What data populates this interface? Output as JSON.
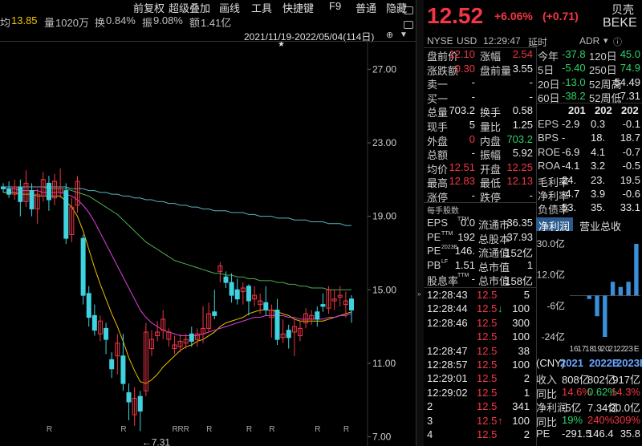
{
  "toolbar": {
    "items": [
      "前复权",
      "超级叠加",
      "画线",
      "工具",
      "快捷键",
      "F9",
      "普通",
      "隐藏"
    ]
  },
  "stats_bar": {
    "avg_label": "均",
    "avg_value": "13.85",
    "vol_label": "量",
    "vol_value": "1020万",
    "turnover_label": "换",
    "turnover_value": "0.84%",
    "amp_label": "振",
    "amp_value": "9.08%",
    "amount_label": "额",
    "amount_value": "1.41亿"
  },
  "range_label": "2021/11/19-2022/05/04(114日)",
  "chart_data": {
    "type": "candlestick",
    "ylim": [
      6.5,
      28.5
    ],
    "y_ticks": [
      "27.00",
      "23.00",
      "19.00",
      "15.00",
      "11.00",
      "7.00"
    ],
    "y_tick_values": [
      27,
      23,
      19,
      15,
      11,
      7
    ],
    "low_annotation": "←7.31",
    "low_value": 7.31,
    "marker": "R",
    "candles": [
      {
        "o": 20.6,
        "c": 20.5,
        "h": 20.8,
        "l": 20.3
      },
      {
        "o": 20.5,
        "c": 20.2,
        "h": 20.9,
        "l": 20.0
      },
      {
        "o": 20.2,
        "c": 20.6,
        "h": 21.0,
        "l": 19.9
      },
      {
        "o": 20.6,
        "c": 19.8,
        "h": 21.0,
        "l": 19.0
      },
      {
        "o": 19.8,
        "c": 20.8,
        "h": 21.5,
        "l": 19.5
      },
      {
        "o": 20.4,
        "c": 19.4,
        "h": 20.8,
        "l": 19.0
      },
      {
        "o": 19.4,
        "c": 20.2,
        "h": 20.5,
        "l": 18.6
      },
      {
        "o": 20.1,
        "c": 21.0,
        "h": 21.4,
        "l": 19.8
      },
      {
        "o": 20.8,
        "c": 19.9,
        "h": 21.2,
        "l": 19.3
      },
      {
        "o": 20.0,
        "c": 20.9,
        "h": 21.3,
        "l": 19.6
      },
      {
        "o": 20.3,
        "c": 20.5,
        "h": 21.6,
        "l": 20.0
      },
      {
        "o": 20.4,
        "c": 17.8,
        "h": 20.8,
        "l": 17.5
      },
      {
        "o": 18.0,
        "c": 19.5,
        "h": 20.0,
        "l": 17.6
      },
      {
        "o": 19.6,
        "c": 20.9,
        "h": 21.2,
        "l": 19.2
      },
      {
        "o": 17.8,
        "c": 14.7,
        "h": 18.0,
        "l": 14.2
      },
      {
        "o": 14.8,
        "c": 13.5,
        "h": 15.2,
        "l": 13.0
      },
      {
        "o": 13.6,
        "c": 12.8,
        "h": 14.2,
        "l": 12.5
      },
      {
        "o": 12.6,
        "c": 13.3,
        "h": 13.6,
        "l": 12.2
      },
      {
        "o": 12.9,
        "c": 12.3,
        "h": 13.2,
        "l": 11.5
      },
      {
        "o": 11.2,
        "c": 10.7,
        "h": 11.6,
        "l": 10.2
      },
      {
        "o": 11.4,
        "c": 12.1,
        "h": 12.6,
        "l": 10.4
      },
      {
        "o": 11.4,
        "c": 9.9,
        "h": 12.6,
        "l": 9.5
      },
      {
        "o": 9.4,
        "c": 8.9,
        "h": 9.9,
        "l": 7.9
      },
      {
        "o": 8.2,
        "c": 9.1,
        "h": 9.7,
        "l": 7.6
      },
      {
        "o": 9.2,
        "c": 8.4,
        "h": 9.5,
        "l": 7.31
      },
      {
        "o": 9.5,
        "c": 12.7,
        "h": 13.2,
        "l": 9.2
      },
      {
        "o": 11.8,
        "c": 12.3,
        "h": 12.8,
        "l": 11.4
      },
      {
        "o": 12.5,
        "c": 12.7,
        "h": 13.3,
        "l": 12.2
      },
      {
        "o": 12.8,
        "c": 13.4,
        "h": 13.9,
        "l": 12.3
      },
      {
        "o": 12.3,
        "c": 12.7,
        "h": 12.9,
        "l": 11.9
      },
      {
        "o": 11.8,
        "c": 12.0,
        "h": 12.5,
        "l": 11.5
      },
      {
        "o": 11.9,
        "c": 12.2,
        "h": 12.6,
        "l": 11.6
      },
      {
        "o": 12.1,
        "c": 12.3,
        "h": 12.6,
        "l": 11.8
      },
      {
        "o": 12.6,
        "c": 12.2,
        "h": 13.0,
        "l": 11.9
      },
      {
        "o": 12.3,
        "c": 12.6,
        "h": 12.9,
        "l": 11.9
      },
      {
        "o": 12.6,
        "c": 12.9,
        "h": 14.1,
        "l": 12.1
      },
      {
        "o": 12.9,
        "c": 13.7,
        "h": 14.3,
        "l": 12.7
      },
      {
        "o": 13.8,
        "c": 13.6,
        "h": 15.0,
        "l": 13.4
      },
      {
        "o": 16.0,
        "c": 16.3,
        "h": 16.5,
        "l": 15.4
      },
      {
        "o": 15.7,
        "c": 15.4,
        "h": 16.0,
        "l": 15.1
      },
      {
        "o": 15.4,
        "c": 14.7,
        "h": 15.9,
        "l": 14.3
      },
      {
        "o": 15.0,
        "c": 14.5,
        "h": 15.6,
        "l": 14.2
      },
      {
        "o": 14.9,
        "c": 15.1,
        "h": 15.4,
        "l": 14.2
      },
      {
        "o": 15.2,
        "c": 14.4,
        "h": 15.3,
        "l": 13.6
      },
      {
        "o": 14.5,
        "c": 14.7,
        "h": 15.2,
        "l": 14.1
      },
      {
        "o": 14.2,
        "c": 14.4,
        "h": 14.8,
        "l": 13.7
      },
      {
        "o": 14.3,
        "c": 13.9,
        "h": 15.2,
        "l": 13.6
      },
      {
        "o": 13.5,
        "c": 13.9,
        "h": 14.2,
        "l": 12.4
      },
      {
        "o": 13.9,
        "c": 12.3,
        "h": 14.5,
        "l": 12.0
      },
      {
        "o": 12.4,
        "c": 12.6,
        "h": 13.4,
        "l": 12.1
      },
      {
        "o": 12.8,
        "c": 12.4,
        "h": 13.1,
        "l": 11.8
      },
      {
        "o": 12.7,
        "c": 13.0,
        "h": 13.4,
        "l": 11.4
      },
      {
        "o": 12.5,
        "c": 12.9,
        "h": 13.3,
        "l": 12.2
      },
      {
        "o": 13.2,
        "c": 13.7,
        "h": 14.0,
        "l": 12.9
      },
      {
        "o": 13.4,
        "c": 13.6,
        "h": 13.9,
        "l": 13.1
      },
      {
        "o": 13.8,
        "c": 13.4,
        "h": 14.1,
        "l": 13.0
      },
      {
        "o": 14.2,
        "c": 14.1,
        "h": 14.8,
        "l": 13.8
      },
      {
        "o": 14.0,
        "c": 15.0,
        "h": 15.2,
        "l": 13.7
      },
      {
        "o": 14.4,
        "c": 14.5,
        "h": 15.0,
        "l": 13.9
      },
      {
        "o": 14.6,
        "c": 14.7,
        "h": 15.2,
        "l": 14.1
      },
      {
        "o": 14.2,
        "c": 14.4,
        "h": 14.9,
        "l": 13.5
      },
      {
        "o": 14.5,
        "c": 13.9,
        "h": 14.7,
        "l": 13.2
      }
    ],
    "ma_lines": [
      {
        "name": "ma-yellow",
        "color": "#e8c000",
        "values": [
          20.3,
          20.3,
          20.3,
          20.2,
          20.2,
          20.2,
          20.1,
          20.1,
          20.1,
          20.1,
          20.1,
          19.8,
          19.5,
          19.0,
          18.2,
          17.2,
          16.2,
          15.3,
          14.5,
          13.7,
          13.0,
          12.2,
          11.3,
          10.6,
          10.0,
          9.9,
          10.1,
          10.4,
          10.8,
          11.1,
          11.4,
          11.7,
          11.9,
          12.0,
          12.2,
          12.3,
          12.5,
          12.7,
          13.0,
          13.2,
          13.3,
          13.4,
          13.5,
          13.7,
          13.8,
          13.9,
          13.9,
          13.9,
          13.8,
          13.7,
          13.6,
          13.4,
          13.3,
          13.3,
          13.3,
          13.3,
          13.3,
          13.4,
          13.5,
          13.6,
          13.7,
          13.8
        ]
      },
      {
        "name": "ma-magenta",
        "color": "#e040e0",
        "values": [
          20.5,
          20.5,
          20.5,
          20.4,
          20.4,
          20.4,
          20.4,
          20.3,
          20.3,
          20.3,
          20.3,
          20.2,
          20.1,
          19.9,
          19.6,
          19.2,
          18.7,
          18.1,
          17.5,
          16.9,
          16.3,
          15.7,
          15.1,
          14.5,
          13.9,
          13.5,
          13.2,
          13.0,
          12.8,
          12.7,
          12.6,
          12.5,
          12.5,
          12.5,
          12.5,
          12.6,
          12.7,
          12.8,
          12.9,
          13.0,
          13.1,
          13.2,
          13.3,
          13.4,
          13.5,
          13.5,
          13.6,
          13.6,
          13.6,
          13.6,
          13.5,
          13.5,
          13.4,
          13.4,
          13.4,
          13.4,
          13.4,
          13.5,
          13.5,
          13.6,
          13.6,
          13.7
        ]
      },
      {
        "name": "ma-green",
        "color": "#4caf50",
        "values": [
          20.6,
          20.6,
          20.6,
          20.6,
          20.6,
          20.6,
          20.6,
          20.6,
          20.5,
          20.5,
          20.5,
          20.5,
          20.4,
          20.3,
          20.2,
          20.1,
          19.9,
          19.7,
          19.5,
          19.3,
          19.1,
          18.8,
          18.5,
          18.2,
          17.9,
          17.6,
          17.4,
          17.2,
          17.0,
          16.8,
          16.6,
          16.5,
          16.4,
          16.3,
          16.2,
          16.1,
          16.0,
          15.9,
          15.9,
          15.8,
          15.8,
          15.7,
          15.7,
          15.6,
          15.6,
          15.5,
          15.5,
          15.5,
          15.4,
          15.4,
          15.3,
          15.3,
          15.2,
          15.2,
          15.1,
          15.1,
          15.1,
          15.0,
          15.0,
          15.0,
          15.0,
          15.0
        ]
      },
      {
        "name": "ma-cyan",
        "color": "#5ab4be",
        "values": [
          20.6,
          20.6,
          20.6,
          20.6,
          20.6,
          20.6,
          20.6,
          20.6,
          20.6,
          20.6,
          20.6,
          20.6,
          20.5,
          20.5,
          20.5,
          20.4,
          20.4,
          20.3,
          20.3,
          20.2,
          20.2,
          20.1,
          20.1,
          20.0,
          20.0,
          19.9,
          19.9,
          19.8,
          19.8,
          19.7,
          19.7,
          19.6,
          19.6,
          19.5,
          19.5,
          19.4,
          19.4,
          19.3,
          19.3,
          19.3,
          19.2,
          19.2,
          19.2,
          19.1,
          19.1,
          19.0,
          19.0,
          19.0,
          18.9,
          18.9,
          18.9,
          18.8,
          18.8,
          18.8,
          18.7,
          18.7,
          18.7,
          18.6,
          18.6,
          18.6,
          18.5,
          18.5
        ]
      }
    ]
  },
  "quote": {
    "price": "12.52",
    "change_pct": "+6.06%",
    "change": "(+0.71)",
    "name_cn": "贝壳",
    "ticker": "BEKE",
    "exchange": "NYSE",
    "currency": "USD",
    "time": "12:29:47",
    "delay": "延时",
    "adr": "ADR"
  },
  "left_table": [
    {
      "l": "盘前价",
      "v": "12.10",
      "c": "r"
    },
    {
      "l": "涨跌额",
      "v": "0.30",
      "c": "r"
    },
    {
      "l": "卖一",
      "v": "-",
      "c": "w"
    },
    {
      "l": "买一",
      "v": "-",
      "c": "w"
    },
    {
      "l": "总量",
      "v": "703.2",
      "c": "w"
    },
    {
      "l": "现手",
      "v": "5",
      "c": "w"
    },
    {
      "l": "外盘",
      "v": "0",
      "c": "r"
    },
    {
      "l": "总额",
      "v": "-",
      "c": "w"
    },
    {
      "l": "均价",
      "v": "12.51",
      "c": "r"
    },
    {
      "l": "最高",
      "v": "12.83",
      "c": "r"
    },
    {
      "l": "涨停",
      "v": "-",
      "c": "w"
    }
  ],
  "mid_table": [
    {
      "l": "涨幅",
      "v": "2.54",
      "c": "r"
    },
    {
      "l": "盘前量",
      "v": "3.55",
      "c": "w"
    },
    {
      "l": "",
      "v": "-",
      "c": "w"
    },
    {
      "l": "",
      "v": "-",
      "c": "w"
    },
    {
      "l": "换手",
      "v": "0.58",
      "c": "w"
    },
    {
      "l": "量比",
      "v": "1.25",
      "c": "w"
    },
    {
      "l": "内盘",
      "v": "703.2",
      "c": "g"
    },
    {
      "l": "振幅",
      "v": "5.92",
      "c": "w"
    },
    {
      "l": "开盘",
      "v": "12.25",
      "c": "r"
    },
    {
      "l": "最低",
      "v": "12.13",
      "c": "r"
    },
    {
      "l": "跌停",
      "v": "-",
      "c": "w"
    }
  ],
  "fundamentals_header": "每手股数",
  "fund_table": [
    {
      "l": "EPS",
      "sup": "TTM",
      "v": "0.0",
      "l2": "流通市",
      "v2": "36.35"
    },
    {
      "l": "PE",
      "sup": "TTM",
      "v": "192",
      "l2": "总股本",
      "v2": "37.93"
    },
    {
      "l": "PE",
      "sup": "2023E",
      "v": "146.",
      "l2": "流通值",
      "v2": "152亿"
    },
    {
      "l": "PB",
      "sup": "LF",
      "v": "1.51",
      "l2": "总市值",
      "v2": "1"
    },
    {
      "l": "股息率",
      "sup": "TTM",
      "v": "-",
      "l2": "总市值",
      "v2": "158亿"
    }
  ],
  "ticks": [
    {
      "t": "12:28:43",
      "p": "12.5",
      "arrow": "",
      "q": "5"
    },
    {
      "t": "12:28:44",
      "p": "12.5",
      "arrow": "↓",
      "q": "100"
    },
    {
      "t": "12:28:46",
      "p": "12.5",
      "arrow": "",
      "q": "300"
    },
    {
      "t": "",
      "p": "12.5",
      "arrow": "",
      "q": "100"
    },
    {
      "t": "12:28:47",
      "p": "12.5",
      "arrow": "",
      "q": "38"
    },
    {
      "t": "12:28:57",
      "p": "12.5",
      "arrow": "",
      "q": "100"
    },
    {
      "t": "12:29:01",
      "p": "12.5",
      "arrow": "",
      "q": "2"
    },
    {
      "t": "12:29:02",
      "p": "12.5",
      "arrow": "",
      "q": "1"
    },
    {
      "t": "2",
      "p": "12.5",
      "arrow": "",
      "q": "341"
    },
    {
      "t": "3",
      "p": "12.5",
      "arrow": "↑",
      "q": "100"
    },
    {
      "t": "4",
      "p": "12.5",
      "arrow": "",
      "q": "2"
    }
  ],
  "right_stats": [
    {
      "l": "今年",
      "v": "-37.8",
      "l2": "120日",
      "v2": "45.0",
      "c": "g",
      "c2": "g"
    },
    {
      "l": "5日",
      "v": "-5.40",
      "l2": "250日",
      "v2": "74.9",
      "c": "g",
      "c2": "g"
    },
    {
      "l": "20日",
      "v": "-13.0",
      "l2": "52周高",
      "v2": "54.49",
      "c": "g",
      "c2": "w"
    },
    {
      "l": "60日",
      "v": "-38.2",
      "l2": "52周低",
      "v2": "7.31",
      "c": "g",
      "c2": "w"
    }
  ],
  "fin_header": [
    "201",
    "202",
    "202"
  ],
  "fin_rows": [
    {
      "l": "EPS",
      "a": "-2.9",
      "b": "0.3",
      "c": "-0.1"
    },
    {
      "l": "BPS",
      "a": "-",
      "b": "18.",
      "c": "18.7"
    },
    {
      "l": "ROE",
      "a": "-6.9",
      "b": "4.1",
      "c": "-0.7"
    },
    {
      "l": "ROA",
      "a": "-4.1",
      "b": "3.2",
      "c": "-0.5"
    },
    {
      "l": "毛利率",
      "a": "24.",
      "b": "23.",
      "c": "19.5"
    },
    {
      "l": "净利率",
      "a": "-4.7",
      "b": "3.9",
      "c": "-0.6"
    },
    {
      "l": "负债率",
      "a": "53.",
      "b": "35.",
      "c": "33.1"
    }
  ],
  "fin_tabs": [
    "净利润",
    "营业总收"
  ],
  "bar_chart": {
    "y_labels": [
      "30.0亿",
      "12.0亿",
      "-6亿",
      "-24亿"
    ],
    "x_labels": [
      "16",
      "17",
      "18",
      "19",
      "20",
      "21",
      "22",
      "23",
      "E"
    ],
    "values": [
      0,
      0,
      -2,
      -12,
      -24,
      8,
      5,
      8,
      30
    ]
  },
  "forecast": {
    "header": [
      "(CNY)",
      "2021",
      "2022E",
      "2023E"
    ],
    "rows": [
      {
        "l": "收入",
        "a": "808亿",
        "b": "802亿",
        "c": "917亿",
        "ca": "w",
        "cb": "w",
        "cc": "w"
      },
      {
        "l": "同比",
        "a": "14.6%",
        "b": "0.62%",
        "c": "14.3%",
        "ca": "r",
        "cb": "g",
        "cc": "r"
      },
      {
        "l": "净利润",
        "a": "-5亿",
        "b": "7.34亿",
        "c": "30.0亿",
        "ca": "w",
        "cb": "w",
        "cc": "w"
      },
      {
        "l": "同比",
        "a": "19%",
        "b": "240%",
        "c": "309%",
        "ca": "g",
        "cb": "r",
        "cc": "r"
      },
      {
        "l": "PE",
        "a": "-291.5",
        "b": "146.4",
        "c": "35.8",
        "ca": "w",
        "cb": "w",
        "cc": "w"
      }
    ]
  }
}
